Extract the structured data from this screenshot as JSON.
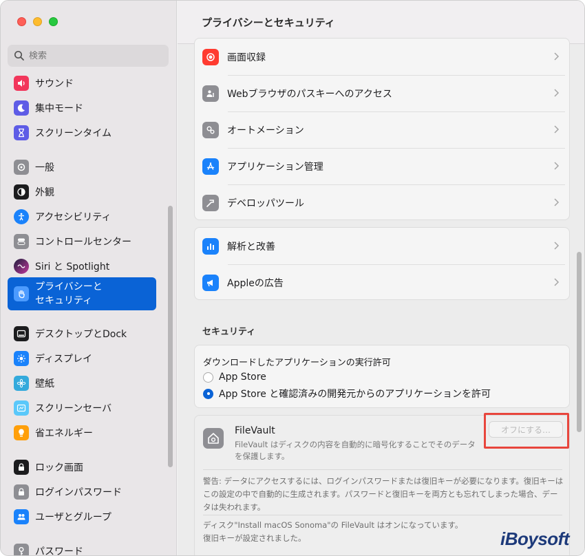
{
  "sidebar": {
    "search_placeholder": "検索",
    "items": [
      {
        "label": "サウンド",
        "color": "#f2365b"
      },
      {
        "label": "集中モード",
        "color": "#5e5ce6"
      },
      {
        "label": "スクリーンタイム",
        "color": "#5e5ce6"
      },
      {
        "label": "一般",
        "color": "#8e8e93"
      },
      {
        "label": "外観",
        "color": "#1c1c1e"
      },
      {
        "label": "アクセシビリティ",
        "color": "#1a82fb"
      },
      {
        "label": "コントロールセンター",
        "color": "#8e8e93"
      },
      {
        "label": "Siri と Spotlight",
        "color": "#8f44ad"
      },
      {
        "label_line1": "プライバシーと",
        "label_line2": "セキュリティ",
        "color": "#1a82fb"
      },
      {
        "label": "デスクトップとDock",
        "color": "#1c1c1e"
      },
      {
        "label": "ディスプレイ",
        "color": "#1a82fb"
      },
      {
        "label": "壁紙",
        "color": "#34aadc"
      },
      {
        "label": "スクリーンセーバ",
        "color": "#5ac8fa"
      },
      {
        "label": "省エネルギー",
        "color": "#ff9f0a"
      },
      {
        "label": "ロック画面",
        "color": "#1c1c1e"
      },
      {
        "label": "ログインパスワード",
        "color": "#8e8e93"
      },
      {
        "label": "ユーザとグループ",
        "color": "#1a82fb"
      },
      {
        "label": "パスワード",
        "color": "#8e8e93"
      }
    ]
  },
  "header": {
    "title": "プライバシーとセキュリティ"
  },
  "privacy_rows": [
    {
      "label": "画面収録",
      "color": "#ff3b30"
    },
    {
      "label": "Webブラウザのパスキーへのアクセス",
      "color": "#8e8e93"
    },
    {
      "label": "オートメーション",
      "color": "#8e8e93"
    },
    {
      "label": "アプリケーション管理",
      "color": "#1a82fb"
    },
    {
      "label": "デベロッパツール",
      "color": "#8e8e93"
    }
  ],
  "analytics_rows": [
    {
      "label": "解析と改善",
      "color": "#1a82fb"
    },
    {
      "label": "Appleの広告",
      "color": "#1a82fb"
    }
  ],
  "security": {
    "section_title": "セキュリティ",
    "download_title": "ダウンロードしたアプリケーションの実行許可",
    "option1": "App Store",
    "option2": "App Store と確認済みの開発元からのアプリケーションを許可",
    "selected_option": 2
  },
  "filevault": {
    "title": "FileVault",
    "description": "FileVault はディスクの内容を自動的に暗号化することでそのデータを保護します。",
    "button_label": "オフにする…",
    "warning": "警告: データにアクセスするには、ログインパスワードまたは復旧キーが必要になります。復旧キーはこの設定の中で自動的に生成されます。パスワードと復旧キーを両方とも忘れてしまった場合、データは失われます。",
    "status_line1": "ディスク\"Install macOS Sonoma\"の FileVault はオンになっています。",
    "status_line2": "復旧キーが設定されました。"
  },
  "watermark": "iBoysoft"
}
